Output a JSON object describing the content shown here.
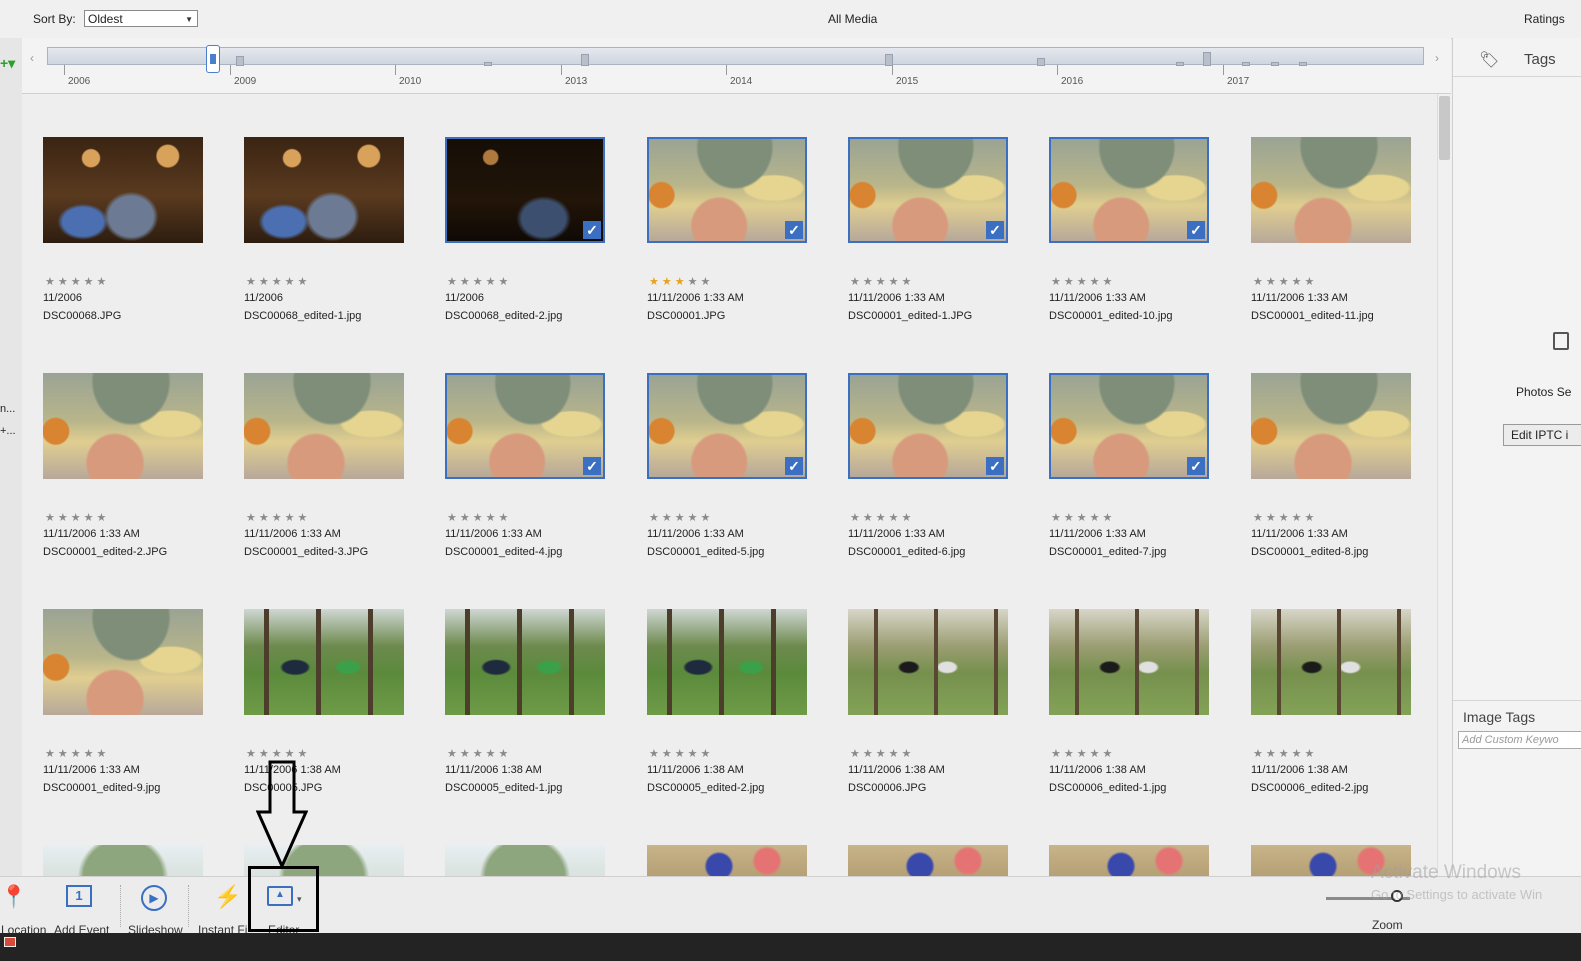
{
  "header": {
    "sort_label": "Sort By:",
    "sort_value": "Oldest",
    "view_title": "All Media",
    "ratings_label": "Ratings"
  },
  "left_panel": {
    "text1": "n...",
    "text2": "+..."
  },
  "timeline": {
    "years": [
      "2006",
      "2009",
      "2010",
      "2013",
      "2014",
      "2015",
      "2016",
      "2017"
    ]
  },
  "grid": {
    "rows": [
      [
        {
          "photo": "party",
          "selected": false,
          "rating": 0,
          "date": "11/2006",
          "file": "DSC00068.JPG"
        },
        {
          "photo": "party",
          "selected": false,
          "rating": 0,
          "date": "11/2006",
          "file": "DSC00068_edited-1.jpg"
        },
        {
          "photo": "party-dark",
          "selected": true,
          "rating": 0,
          "date": "11/2006",
          "file": "DSC00068_edited-2.jpg"
        },
        {
          "photo": "tent",
          "selected": true,
          "rating": 3,
          "date": "11/11/2006 1:33 AM",
          "file": "DSC00001.JPG"
        },
        {
          "photo": "tent",
          "selected": true,
          "rating": 0,
          "date": "11/11/2006 1:33 AM",
          "file": "DSC00001_edited-1.JPG"
        },
        {
          "photo": "tent",
          "selected": true,
          "rating": 0,
          "date": "11/11/2006 1:33 AM",
          "file": "DSC00001_edited-10.jpg"
        },
        {
          "photo": "tent",
          "selected": false,
          "rating": 0,
          "date": "11/11/2006 1:33 AM",
          "file": "DSC00001_edited-11.jpg"
        }
      ],
      [
        {
          "photo": "tent",
          "selected": false,
          "rating": 0,
          "date": "11/11/2006 1:33 AM",
          "file": "DSC00001_edited-2.JPG"
        },
        {
          "photo": "tent",
          "selected": false,
          "rating": 0,
          "date": "11/11/2006 1:33 AM",
          "file": "DSC00001_edited-3.JPG"
        },
        {
          "photo": "tent",
          "selected": true,
          "rating": 0,
          "date": "11/11/2006 1:33 AM",
          "file": "DSC00001_edited-4.jpg"
        },
        {
          "photo": "tent",
          "selected": true,
          "rating": 0,
          "date": "11/11/2006 1:33 AM",
          "file": "DSC00001_edited-5.jpg"
        },
        {
          "photo": "tent",
          "selected": true,
          "rating": 0,
          "date": "11/11/2006 1:33 AM",
          "file": "DSC00001_edited-6.jpg"
        },
        {
          "photo": "tent",
          "selected": true,
          "rating": 0,
          "date": "11/11/2006 1:33 AM",
          "file": "DSC00001_edited-7.jpg"
        },
        {
          "photo": "tent",
          "selected": false,
          "rating": 0,
          "date": "11/11/2006 1:33 AM",
          "file": "DSC00001_edited-8.jpg"
        }
      ],
      [
        {
          "photo": "tent",
          "selected": false,
          "rating": 0,
          "date": "11/11/2006 1:33 AM",
          "file": "DSC00001_edited-9.jpg"
        },
        {
          "photo": "trees",
          "selected": false,
          "rating": 0,
          "date": "11/11/2006 1:38 AM",
          "file": "DSC00005.JPG"
        },
        {
          "photo": "trees",
          "selected": false,
          "rating": 0,
          "date": "11/11/2006 1:38 AM",
          "file": "DSC00005_edited-1.jpg"
        },
        {
          "photo": "trees",
          "selected": false,
          "rating": 0,
          "date": "11/11/2006 1:38 AM",
          "file": "DSC00005_edited-2.jpg"
        },
        {
          "photo": "swing",
          "selected": false,
          "rating": 0,
          "date": "11/11/2006 1:38 AM",
          "file": "DSC00006.JPG"
        },
        {
          "photo": "swing",
          "selected": false,
          "rating": 0,
          "date": "11/11/2006 1:38 AM",
          "file": "DSC00006_edited-1.jpg"
        },
        {
          "photo": "swing",
          "selected": false,
          "rating": 0,
          "date": "11/11/2006 1:38 AM",
          "file": "DSC00006_edited-2.jpg"
        }
      ],
      [
        {
          "photo": "hill"
        },
        {
          "photo": "hill"
        },
        {
          "photo": "hill"
        },
        {
          "photo": "lodge"
        },
        {
          "photo": "lodge"
        },
        {
          "photo": "lodge"
        },
        {
          "photo": "lodge"
        }
      ]
    ]
  },
  "right_panel": {
    "tags_title": "Tags",
    "photos_label": "Photos Se",
    "edit_iptc": "Edit IPTC i",
    "image_tags_title": "Image Tags",
    "custom_keyword_placeholder": "Add Custom Keywo"
  },
  "toolbar": {
    "location": "Location",
    "add_event": "Add Event",
    "slideshow": "Slideshow",
    "instant_fix": "Instant Fi",
    "editor": "Editor",
    "zoom": "Zoom",
    "zoom_level": 0.85
  },
  "watermark": {
    "line1": "Activate Windows",
    "line2": "Go to Settings to activate Win"
  },
  "colors": {
    "selection": "#3a6fc2",
    "star_on": "#e8a21a",
    "star_off": "#8a8a8a"
  }
}
